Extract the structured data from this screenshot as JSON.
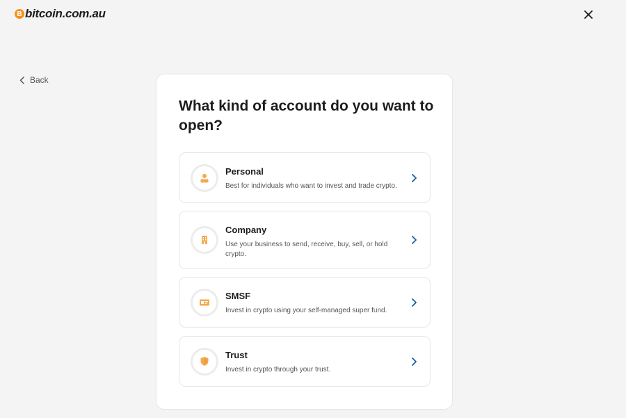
{
  "header": {
    "logo_mark": "B",
    "logo_text": "bitcoin.com.au"
  },
  "nav": {
    "back_label": "Back"
  },
  "card": {
    "title": "What kind of account do you want to open?",
    "options": [
      {
        "title": "Personal",
        "description": "Best for individuals who want to invest and trade crypto.",
        "icon": "person-icon"
      },
      {
        "title": "Company",
        "description": "Use your business to send, receive, buy, sell, or hold crypto.",
        "icon": "building-icon"
      },
      {
        "title": "SMSF",
        "description": "Invest in crypto using your self-managed super fund.",
        "icon": "id-card-icon"
      },
      {
        "title": "Trust",
        "description": "Invest in crypto through your trust.",
        "icon": "shield-icon"
      }
    ]
  },
  "colors": {
    "brand_orange": "#f7931a",
    "icon_orange": "#f5a94e",
    "chevron_blue": "#1a5fa0",
    "background": "#f4f4f4"
  }
}
